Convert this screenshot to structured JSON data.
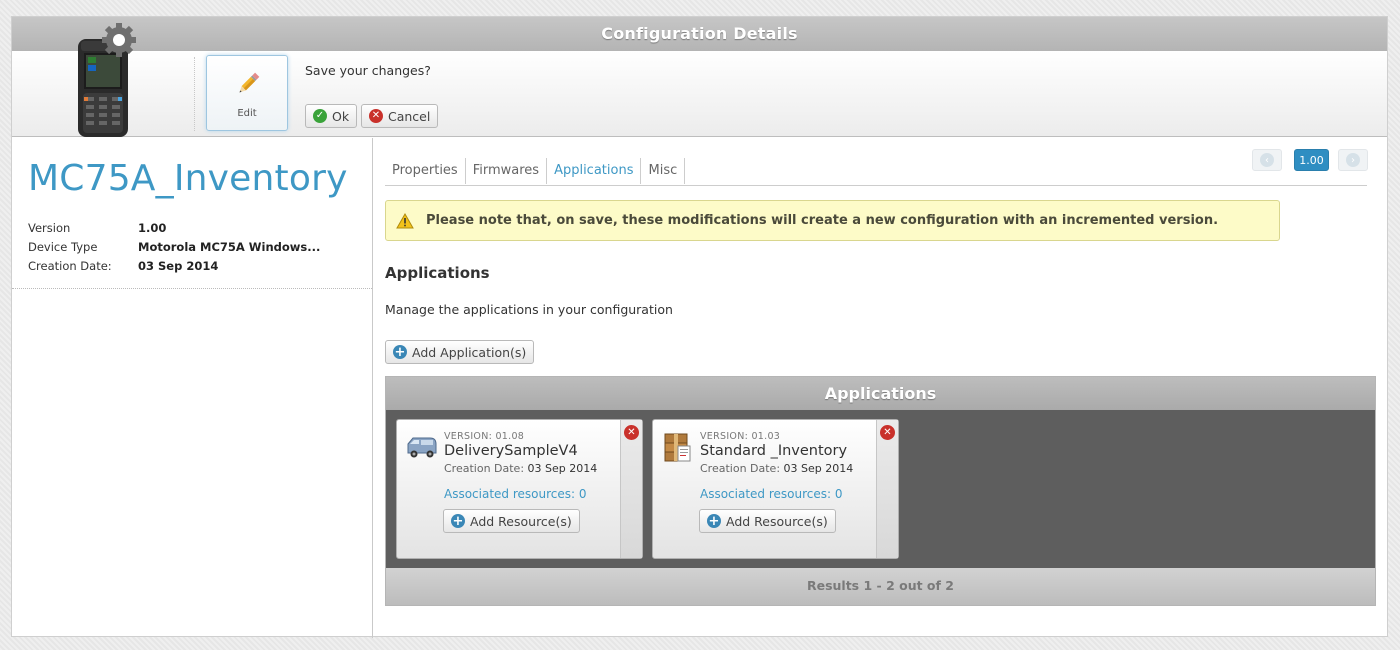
{
  "window": {
    "title": "Configuration Details"
  },
  "toolbar": {
    "edit_label": "Edit",
    "save_prompt": "Save your changes?",
    "ok_label": "Ok",
    "cancel_label": "Cancel"
  },
  "config": {
    "name": "MC75A_Inventory",
    "fields": [
      {
        "label": "Version",
        "value": "1.00"
      },
      {
        "label": "Device Type",
        "value": "Motorola MC75A Windows..."
      },
      {
        "label": "Creation Date:",
        "value": "03 Sep 2014"
      }
    ]
  },
  "tabs": [
    {
      "label": "Properties",
      "active": false
    },
    {
      "label": "Firmwares",
      "active": false
    },
    {
      "label": "Applications",
      "active": true
    },
    {
      "label": "Misc",
      "active": false
    }
  ],
  "pager": {
    "current_version": "1.00"
  },
  "notice": {
    "text": "Please note that, on save, these modifications will create a new configuration with an incremented version."
  },
  "section": {
    "title": "Applications",
    "description": "Manage the applications in your configuration",
    "add_button": "Add Application(s)"
  },
  "apps_panel": {
    "title": "Applications",
    "results": "Results 1 - 2 out of 2",
    "items": [
      {
        "version": "VERSION: 01.08",
        "name": "DeliverySampleV4",
        "creation_label": "Creation Date:",
        "creation_date": "03 Sep 2014",
        "resources": "Associated resources: 0",
        "add_resource": "Add Resource(s)",
        "icon": "delivery-van-icon"
      },
      {
        "version": "VERSION: 01.03",
        "name": "Standard _Inventory",
        "creation_label": "Creation Date:",
        "creation_date": "03 Sep 2014",
        "resources": "Associated resources: 0",
        "add_resource": "Add Resource(s)",
        "icon": "inventory-boxes-icon"
      }
    ]
  },
  "colors": {
    "accent": "#3e98c5",
    "warning_bg": "#fdfbc8",
    "panel_dark": "#5e5e5e"
  }
}
